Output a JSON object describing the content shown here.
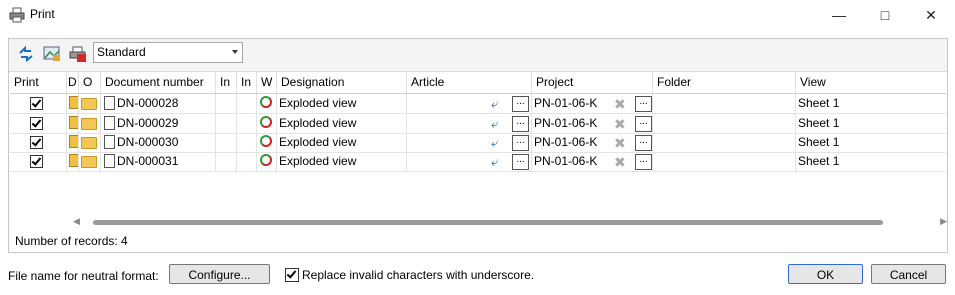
{
  "window": {
    "title": "Print",
    "minimize_icon": "minimize-icon",
    "maximize_icon": "maximize-icon",
    "close_icon": "close-icon"
  },
  "toolbar": {
    "icons": [
      "refresh-arrows-icon",
      "image-settings-icon",
      "printer-icon"
    ],
    "view_select": {
      "selected": "Standard"
    }
  },
  "grid": {
    "columns": [
      "Print",
      "D",
      "O",
      "Document number",
      "In",
      "In",
      "W",
      "Designation",
      "Article",
      "Project",
      "Folder",
      "View"
    ],
    "rows": [
      {
        "print": true,
        "document_number": "DN-000028",
        "designation": "Exploded view",
        "article": "",
        "project": "PN-01-06-K",
        "folder": "",
        "view": "Sheet 1"
      },
      {
        "print": true,
        "document_number": "DN-000029",
        "designation": "Exploded view",
        "article": "",
        "project": "PN-01-06-K",
        "folder": "",
        "view": "Sheet 1"
      },
      {
        "print": true,
        "document_number": "DN-000030",
        "designation": "Exploded view",
        "article": "",
        "project": "PN-01-06-K",
        "folder": "",
        "view": "Sheet 1"
      },
      {
        "print": true,
        "document_number": "DN-000031",
        "designation": "Exploded view",
        "article": "",
        "project": "PN-01-06-K",
        "folder": "",
        "view": "Sheet 1"
      }
    ],
    "dots_label": "...",
    "records_label": "Number of records: 4"
  },
  "footer": {
    "file_name_label": "File name for neutral format:",
    "configure_button": "Configure...",
    "replace_checkbox": {
      "checked": true,
      "label": "Replace invalid characters with underscore."
    },
    "ok_button": "OK",
    "cancel_button": "Cancel"
  }
}
